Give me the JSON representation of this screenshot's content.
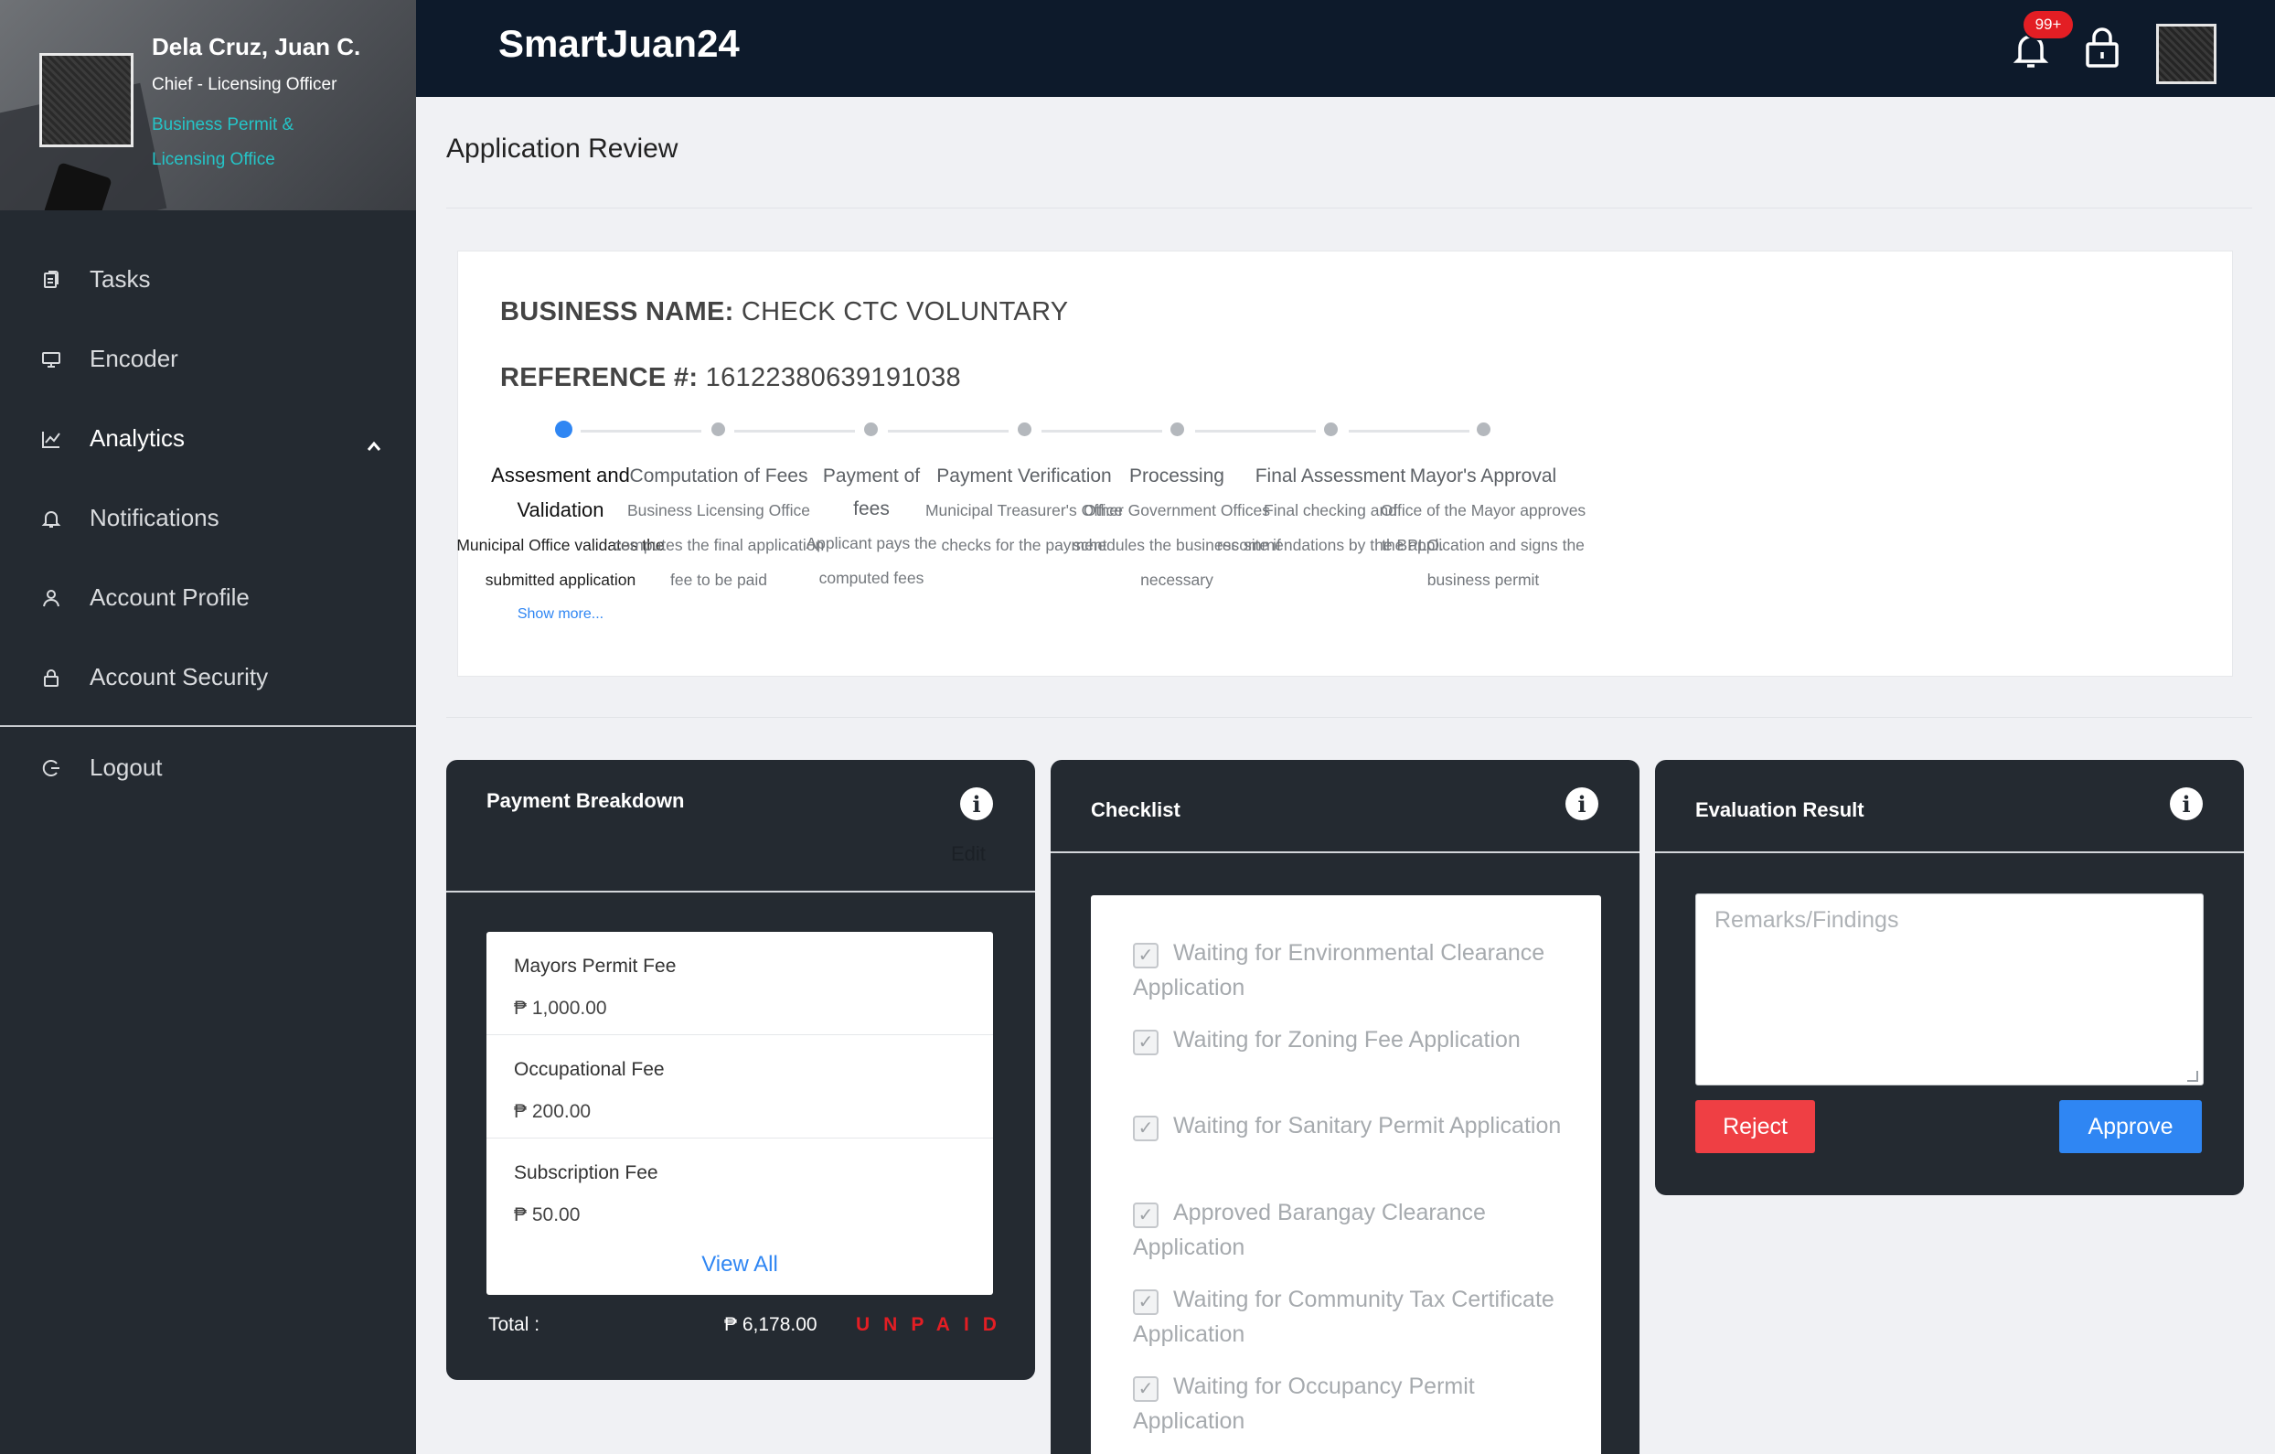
{
  "profile": {
    "name": "Dela Cruz, Juan C.",
    "role": "Chief - Licensing Officer",
    "office_line1": "Business Permit &",
    "office_line2": "Licensing Office"
  },
  "sidebar": {
    "items": [
      {
        "label": "Tasks",
        "icon": "clipboard-icon"
      },
      {
        "label": "Encoder",
        "icon": "monitor-icon"
      },
      {
        "label": "Analytics",
        "icon": "line-chart-icon"
      },
      {
        "label": "Notifications",
        "icon": "bell-icon"
      },
      {
        "label": "Account Profile",
        "icon": "user-icon"
      },
      {
        "label": "Account Security",
        "icon": "lock-icon"
      }
    ],
    "logout": "Logout"
  },
  "header": {
    "brand": "SmartJuan24",
    "notification_badge": "99+"
  },
  "page": {
    "title": "Application Review"
  },
  "application": {
    "business_name_label": "BUSINESS NAME:",
    "business_name": "CHECK CTC VOLUNTARY",
    "reference_label": "REFERENCE #:",
    "reference": "16122380639191038"
  },
  "steps": [
    {
      "title": "Assesment and Validation",
      "desc": "Municipal Office validates the submitted application",
      "show_more": "Show more...",
      "active": true
    },
    {
      "title": "Computation of Fees",
      "desc": "Business Licensing Office computes the final application fee to be paid"
    },
    {
      "title": "Payment of fees",
      "desc": "Applicant pays the computed fees"
    },
    {
      "title": "Payment Verification",
      "desc": "Municipal Treasurer's Office checks for the payment"
    },
    {
      "title": "Processing",
      "desc": "Other Government Offices schedules the business site if necessary"
    },
    {
      "title": "Final Assessment",
      "desc": "Final checking and recommendations by the BPLO."
    },
    {
      "title": "Mayor's Approval",
      "desc": "Office of the Mayor approves the application and signs the business permit"
    }
  ],
  "payment": {
    "title": "Payment Breakdown",
    "edit": "Edit",
    "fees": [
      {
        "name": "Mayors Permit Fee",
        "amount": "₱ 1,000.00"
      },
      {
        "name": "Occupational Fee",
        "amount": "₱ 200.00"
      },
      {
        "name": "Subscription Fee",
        "amount": "₱ 50.00"
      }
    ],
    "view_all": "View All",
    "total_label": "Total :",
    "total_amount": "₱ 6,178.00",
    "status": "UNPAID"
  },
  "checklist": {
    "title": "Checklist",
    "items": [
      {
        "label": "Waiting for Environmental Clearance Application",
        "checked": true
      },
      {
        "label": "Waiting for Zoning Fee Application",
        "checked": true
      },
      {
        "label": "Waiting for Sanitary Permit Application",
        "checked": true
      },
      {
        "label": "Approved Barangay Clearance Application",
        "checked": true
      },
      {
        "label": "Waiting for Community Tax Certificate Application",
        "checked": true
      },
      {
        "label": "Waiting for Occupancy Permit Application",
        "checked": true
      }
    ]
  },
  "evaluation": {
    "title": "Evaluation Result",
    "remarks_placeholder": "Remarks/Findings",
    "reject": "Reject",
    "approve": "Approve"
  },
  "colors": {
    "sidebar": "#242a31",
    "topbar": "#0d1a2b",
    "accent": "#2f86f3",
    "danger": "#ef3f44",
    "office_text": "#25c4c7"
  }
}
